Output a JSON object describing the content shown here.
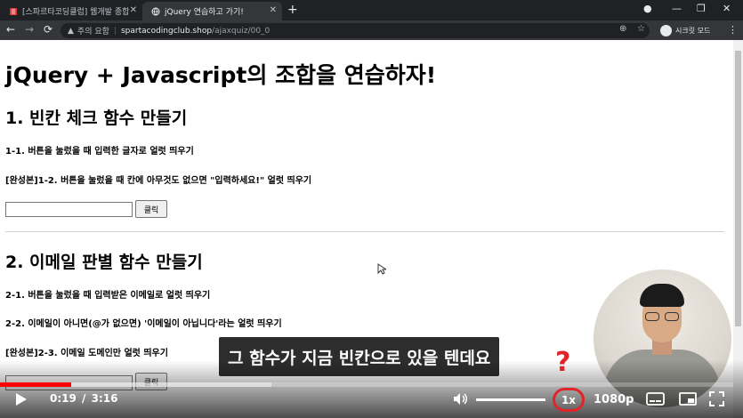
{
  "browser": {
    "tabs": [
      {
        "label": "[스파르타코딩클럽] 웹개발 종합",
        "close": "✕",
        "icon": "book-favicon-icon",
        "active": false
      },
      {
        "label": "jQuery 연습하고 가기!",
        "close": "✕",
        "icon": "globe-favicon-icon",
        "active": true
      }
    ],
    "new_tab": "+",
    "window_controls": {
      "record": "●",
      "minimize": "—",
      "restore": "❐",
      "close": "✕"
    },
    "nav": {
      "back": "←",
      "forward": "→",
      "reload": "⟳"
    },
    "address": {
      "warning_icon": "▲",
      "insecure_label": "주의 요함",
      "separator": "|",
      "domain": "spartacodingclub.shop",
      "path": "/ajaxquiz/00_0"
    },
    "toolbar_icons": {
      "zoom": "⊕",
      "bookmark": "☆"
    },
    "incognito_label": "시크릿 모드",
    "menu": "⋮"
  },
  "page": {
    "title": "jQuery + Javascript의 조합을 연습하자!",
    "section1": {
      "heading": "1. 빈칸 체크 함수 만들기",
      "task1": "1-1. 버튼을 눌렀을 때 입력한 글자로 얼럿 띄우기",
      "task2": "[완성본]1-2. 버튼을 눌렀을 때 칸에 아무것도 없으면 \"입력하세요!\" 얼럿 띄우기",
      "button": "클릭"
    },
    "section2": {
      "heading": "2. 이메일 판별 함수 만들기",
      "task1": "2-1. 버튼을 눌렀을 때 입력받은 이메일로 얼럿 띄우기",
      "task2": "2-2. 이메일이 아니면(@가 없으면) '이메일이 아닙니다'라는 얼럿 띄우기",
      "task3": "[완성본]2-3. 이메일 도메인만 얼럿 띄우기",
      "button": "클릭"
    }
  },
  "player": {
    "caption": "그 함수가 지금 빈칸으로 있을 텐데요",
    "annotation_mark": "?",
    "current_time": "0:19",
    "time_separator": "/",
    "duration": "3:16",
    "played_fraction": 0.097,
    "buffered_fraction": 0.37,
    "volume_fraction": 1.0,
    "speed": "1x",
    "quality": "1080p",
    "icons": {
      "play": "▶",
      "next": "⏭",
      "volume": "🔊",
      "subtitles": "▭",
      "miniplayer": "▣",
      "fullscreen": "⛶"
    },
    "accent_color": "#ff0000",
    "annotation_color": "#e0252a"
  }
}
